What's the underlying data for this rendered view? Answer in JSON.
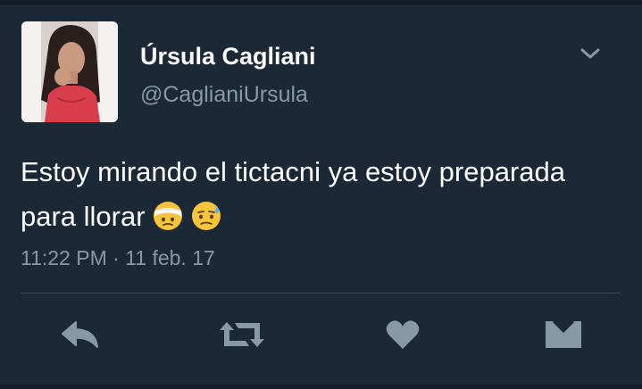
{
  "tweet": {
    "display_name": "Úrsula Cagliani",
    "screen_name": "@CaglianiUrsula",
    "text": "Estoy mirando el tictacni ya estoy preparada para llorar",
    "emojis": [
      "head-bandage-emoji",
      "sweat-face-emoji"
    ],
    "timestamp": "11:22 PM · 11 feb. 17"
  },
  "actions": [
    {
      "name": "reply",
      "icon": "reply-icon"
    },
    {
      "name": "retweet",
      "icon": "retweet-icon"
    },
    {
      "name": "like",
      "icon": "heart-icon"
    },
    {
      "name": "direct-message",
      "icon": "envelope-icon"
    }
  ],
  "colors": {
    "background": "#1b2836",
    "text_primary": "#ffffff",
    "text_secondary": "#8899a6",
    "icon": "#8899a6",
    "divider": "#3a4856"
  }
}
